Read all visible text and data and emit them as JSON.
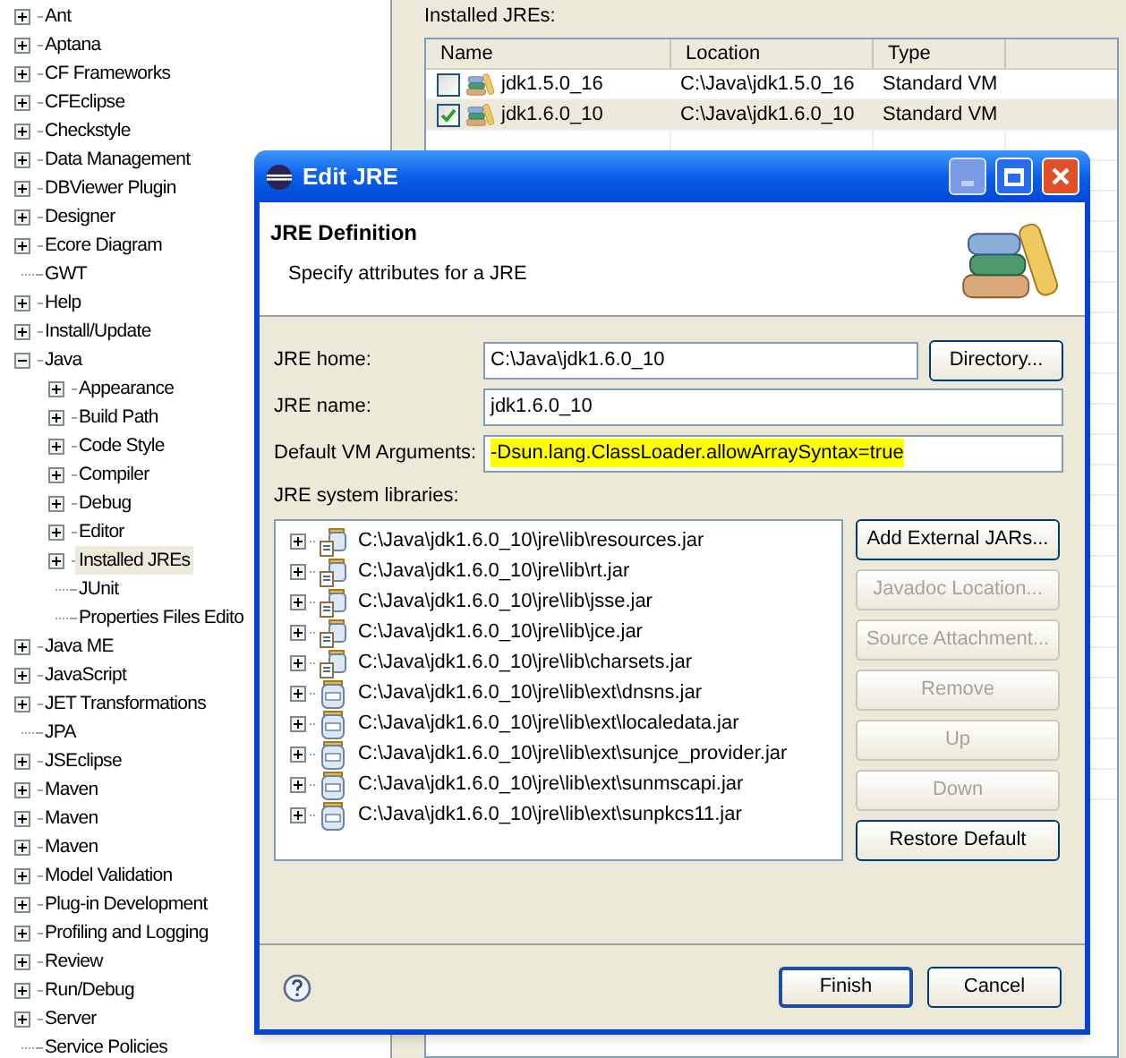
{
  "preferences_tree": [
    {
      "label": "Ant",
      "kind": "node",
      "expanded": false
    },
    {
      "label": "Aptana",
      "kind": "node",
      "expanded": false
    },
    {
      "label": "CF Frameworks",
      "kind": "node",
      "expanded": false
    },
    {
      "label": "CFEclipse",
      "kind": "node",
      "expanded": false
    },
    {
      "label": "Checkstyle",
      "kind": "node",
      "expanded": false
    },
    {
      "label": "Data Management",
      "kind": "node",
      "expanded": false
    },
    {
      "label": "DBViewer Plugin",
      "kind": "node",
      "expanded": false
    },
    {
      "label": "Designer",
      "kind": "node",
      "expanded": false
    },
    {
      "label": "Ecore Diagram",
      "kind": "node",
      "expanded": false
    },
    {
      "label": "GWT",
      "kind": "leaf"
    },
    {
      "label": "Help",
      "kind": "node",
      "expanded": false
    },
    {
      "label": "Install/Update",
      "kind": "node",
      "expanded": false
    },
    {
      "label": "Java",
      "kind": "node",
      "expanded": true,
      "children": [
        {
          "label": "Appearance",
          "kind": "node",
          "expanded": false,
          "selected": false
        },
        {
          "label": "Build Path",
          "kind": "node",
          "expanded": false,
          "selected": false
        },
        {
          "label": "Code Style",
          "kind": "node",
          "expanded": false,
          "selected": false
        },
        {
          "label": "Compiler",
          "kind": "node",
          "expanded": false,
          "selected": false
        },
        {
          "label": "Debug",
          "kind": "node",
          "expanded": false,
          "selected": false
        },
        {
          "label": "Editor",
          "kind": "node",
          "expanded": false,
          "selected": false
        },
        {
          "label": "Installed JREs",
          "kind": "node",
          "expanded": false,
          "selected": true
        },
        {
          "label": "JUnit",
          "kind": "leaf",
          "selected": false
        },
        {
          "label": "Properties Files Edito",
          "kind": "leaf",
          "selected": false
        }
      ]
    },
    {
      "label": "Java ME",
      "kind": "node",
      "expanded": false
    },
    {
      "label": "JavaScript",
      "kind": "node",
      "expanded": false
    },
    {
      "label": "JET Transformations",
      "kind": "node",
      "expanded": false
    },
    {
      "label": "JPA",
      "kind": "leaf"
    },
    {
      "label": "JSEclipse",
      "kind": "node",
      "expanded": false
    },
    {
      "label": "Maven",
      "kind": "node",
      "expanded": false
    },
    {
      "label": "Maven",
      "kind": "node",
      "expanded": false
    },
    {
      "label": "Maven",
      "kind": "node",
      "expanded": false
    },
    {
      "label": "Model Validation",
      "kind": "node",
      "expanded": false
    },
    {
      "label": "Plug-in Development",
      "kind": "node",
      "expanded": false
    },
    {
      "label": "Profiling and Logging",
      "kind": "node",
      "expanded": false
    },
    {
      "label": "Review",
      "kind": "node",
      "expanded": false
    },
    {
      "label": "Run/Debug",
      "kind": "node",
      "expanded": false
    },
    {
      "label": "Server",
      "kind": "node",
      "expanded": false
    },
    {
      "label": "Service Policies",
      "kind": "leaf"
    }
  ],
  "installed_jres": {
    "label": "Installed JREs:",
    "columns": [
      "Name",
      "Location",
      "Type"
    ],
    "rows": [
      {
        "name": "jdk1.5.0_16",
        "location": "C:\\Java\\jdk1.5.0_16",
        "type": "Standard VM",
        "checked": false,
        "selected": false
      },
      {
        "name": "jdk1.6.0_10",
        "location": "C:\\Java\\jdk1.6.0_10",
        "type": "Standard VM",
        "checked": true,
        "selected": true
      }
    ]
  },
  "dialog": {
    "title": "Edit JRE",
    "heading": "JRE Definition",
    "description": "Specify attributes for a JRE",
    "fields": [
      {
        "label": "JRE home:",
        "value": "C:\\Java\\jdk1.6.0_10",
        "button": "Directory..."
      },
      {
        "label": "JRE name:",
        "value": "jdk1.6.0_10"
      },
      {
        "label": "Default VM Arguments:",
        "value": "-Dsun.lang.ClassLoader.allowArraySyntax=true",
        "highlighted": true
      }
    ],
    "libraries_label": "JRE system libraries:",
    "libraries": [
      {
        "kind": "jar",
        "path": "C:\\Java\\jdk1.6.0_10\\jre\\lib\\resources.jar"
      },
      {
        "kind": "jar",
        "path": "C:\\Java\\jdk1.6.0_10\\jre\\lib\\rt.jar"
      },
      {
        "kind": "jar",
        "path": "C:\\Java\\jdk1.6.0_10\\jre\\lib\\jsse.jar"
      },
      {
        "kind": "jar",
        "path": "C:\\Java\\jdk1.6.0_10\\jre\\lib\\jce.jar"
      },
      {
        "kind": "jar",
        "path": "C:\\Java\\jdk1.6.0_10\\jre\\lib\\charsets.jar"
      },
      {
        "kind": "binary",
        "path": "C:\\Java\\jdk1.6.0_10\\jre\\lib\\ext\\dnsns.jar"
      },
      {
        "kind": "binary",
        "path": "C:\\Java\\jdk1.6.0_10\\jre\\lib\\ext\\localedata.jar"
      },
      {
        "kind": "binary",
        "path": "C:\\Java\\jdk1.6.0_10\\jre\\lib\\ext\\sunjce_provider.jar"
      },
      {
        "kind": "binary",
        "path": "C:\\Java\\jdk1.6.0_10\\jre\\lib\\ext\\sunmscapi.jar"
      },
      {
        "kind": "binary",
        "path": "C:\\Java\\jdk1.6.0_10\\jre\\lib\\ext\\sunpkcs11.jar"
      }
    ],
    "library_buttons": [
      {
        "label": "Add External JARs...",
        "disabled": false
      },
      {
        "label": "Javadoc Location...",
        "disabled": true
      },
      {
        "label": "Source Attachment...",
        "disabled": true
      },
      {
        "label": "Remove",
        "disabled": true
      },
      {
        "label": "Up",
        "disabled": true
      },
      {
        "label": "Down",
        "disabled": true
      },
      {
        "label": "Restore Default",
        "disabled": false
      }
    ],
    "buttons": [
      {
        "label": "Finish",
        "default": true
      },
      {
        "label": "Cancel",
        "default": false
      }
    ]
  }
}
